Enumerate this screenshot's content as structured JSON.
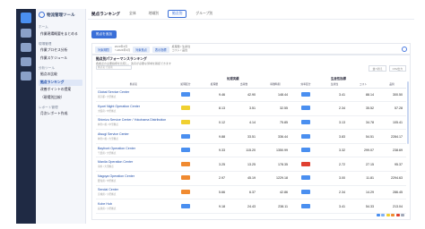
{
  "app": {
    "brand": "物流管理ツール"
  },
  "sidebar": {
    "sections": [
      {
        "header": "ホーム",
        "items": [
          {
            "label": "作業現場概要をまとめる",
            "active": false
          }
        ]
      },
      {
        "header": "現場管理",
        "items": [
          {
            "label": "作業プロセス分析",
            "active": false
          },
          {
            "label": "作業スケジュール",
            "active": false
          }
        ]
      },
      {
        "header": "分析ツール",
        "items": [
          {
            "label": "拠点の比較",
            "active": false
          },
          {
            "label": "拠点ランキング",
            "active": true
          },
          {
            "label": "改善ポイントの提案",
            "active": false
          },
          {
            "label": "（現場別比較）",
            "active": false
          }
        ]
      },
      {
        "header": "レポート管理",
        "items": [
          {
            "label": "月次レポート作成",
            "active": false
          }
        ]
      }
    ]
  },
  "header": {
    "title": "拠点ランキング",
    "tabs": [
      {
        "label": "全体",
        "active": false
      },
      {
        "label": "地域別",
        "active": false
      },
      {
        "label": "拠点別",
        "active": true
      },
      {
        "label": "グループ別",
        "active": false
      }
    ],
    "primary_button": "拠点を追加"
  },
  "filters": {
    "chips": [
      "対象期間",
      "対象拠点"
    ],
    "text1": "2023年4月\n〜2024年3月",
    "chip3": "表示指標",
    "text2": "処理量 / 生産性\nコスト / 品質"
  },
  "card": {
    "title": "拠点別パフォーマンスランキング",
    "subtitle": "各拠点の主要指標を比較し、改善が必要な領域を確認できます",
    "search_placeholder": "拠点名で検索",
    "buttons": [
      "並べ替え",
      "CSV出力"
    ],
    "group_left": "処理実績",
    "group_right": "生産性指標",
    "columns": [
      "拠点名",
      "処理区分",
      "処理量",
      "出荷数",
      "稼働時間",
      "効率区分",
      "生産性",
      "コスト",
      "品質"
    ]
  },
  "rows": [
    {
      "name": "Global Service Center",
      "sub": "東京都 / 大型拠点",
      "cat1": "#4a8ff0",
      "v1": "9.46",
      "v2": "42.90",
      "v3": "148.44",
      "cat2": "#4a8ff0",
      "v4": "3.41",
      "v5": "88.14",
      "v6": "300.50"
    },
    {
      "name": "Kyoei Night Operation Center",
      "sub": "大阪府 / 中型拠点",
      "cat1": "#f0d030",
      "v1": "8.13",
      "v2": "3.51",
      "v3": "32.55",
      "cat2": "#4a8ff0",
      "v4": "2.34",
      "v5": "35.52",
      "v6": "57.28"
    },
    {
      "name": "Shimizu Service Center / Yokohama Distribution",
      "sub": "神奈川県 / 中型拠点",
      "cat1": "#f0d030",
      "v1": "0.12",
      "v2": "4.14",
      "v3": "75.85",
      "cat2": "#4a8ff0",
      "v4": "3.13",
      "v5": "34.78",
      "v6": "105.41"
    },
    {
      "name": "Atsugi Service Center",
      "sub": "神奈川県 / 大型拠点",
      "cat1": "#4a8ff0",
      "v1": "9.88",
      "v2": "33.51",
      "v3": "336.44",
      "cat2": "#4a8ff0",
      "v4": "3.83",
      "v5": "54.51",
      "v6": "2284.17"
    },
    {
      "name": "Bayfront Operation Center",
      "sub": "千葉県 / 大型拠点",
      "cat1": "#4a8ff0",
      "v1": "9.33",
      "v2": "115.20",
      "v3": "1350.99",
      "cat2": "#4a8ff0",
      "v4": "3.32",
      "v5": "299.07",
      "v6": "238.69"
    },
    {
      "name": "Manila Operation Center",
      "sub": "海外 / 大型拠点",
      "cat1": "#f08a30",
      "v1": "3.25",
      "v2": "13.25",
      "v3": "178.35",
      "cat2": "#e04030",
      "v4": "2.72",
      "v5": "27.15",
      "v6": "95.37"
    },
    {
      "name": "Nagoya Operation Center",
      "sub": "愛知県 / 中型拠点",
      "cat1": "#f08a30",
      "v1": "2.97",
      "v2": "45.19",
      "v3": "1229.18",
      "cat2": "#4a8ff0",
      "v4": "3.00",
      "v5": "11.81",
      "v6": "2294.63"
    },
    {
      "name": "Sendai Center",
      "sub": "宮城県 / 小型拠点",
      "cat1": "#f08a30",
      "v1": "5.66",
      "v2": "6.37",
      "v3": "42.86",
      "cat2": "#4a8ff0",
      "v4": "2.34",
      "v5": "14.29",
      "v6": "286.45"
    },
    {
      "name": "Kobe Hub",
      "sub": "兵庫県 / 小型拠点",
      "cat1": "#4a8ff0",
      "v1": "9.18",
      "v2": "24.43",
      "v3": "238.11",
      "cat2": "#4a8ff0",
      "v4": "3.41",
      "v5": "54.33",
      "v6": "213.04"
    }
  ],
  "legend_colors": [
    "#4a8ff0",
    "#7fb2f5",
    "#f0d030",
    "#f08a30",
    "#e04030",
    "#a0a8b8"
  ]
}
